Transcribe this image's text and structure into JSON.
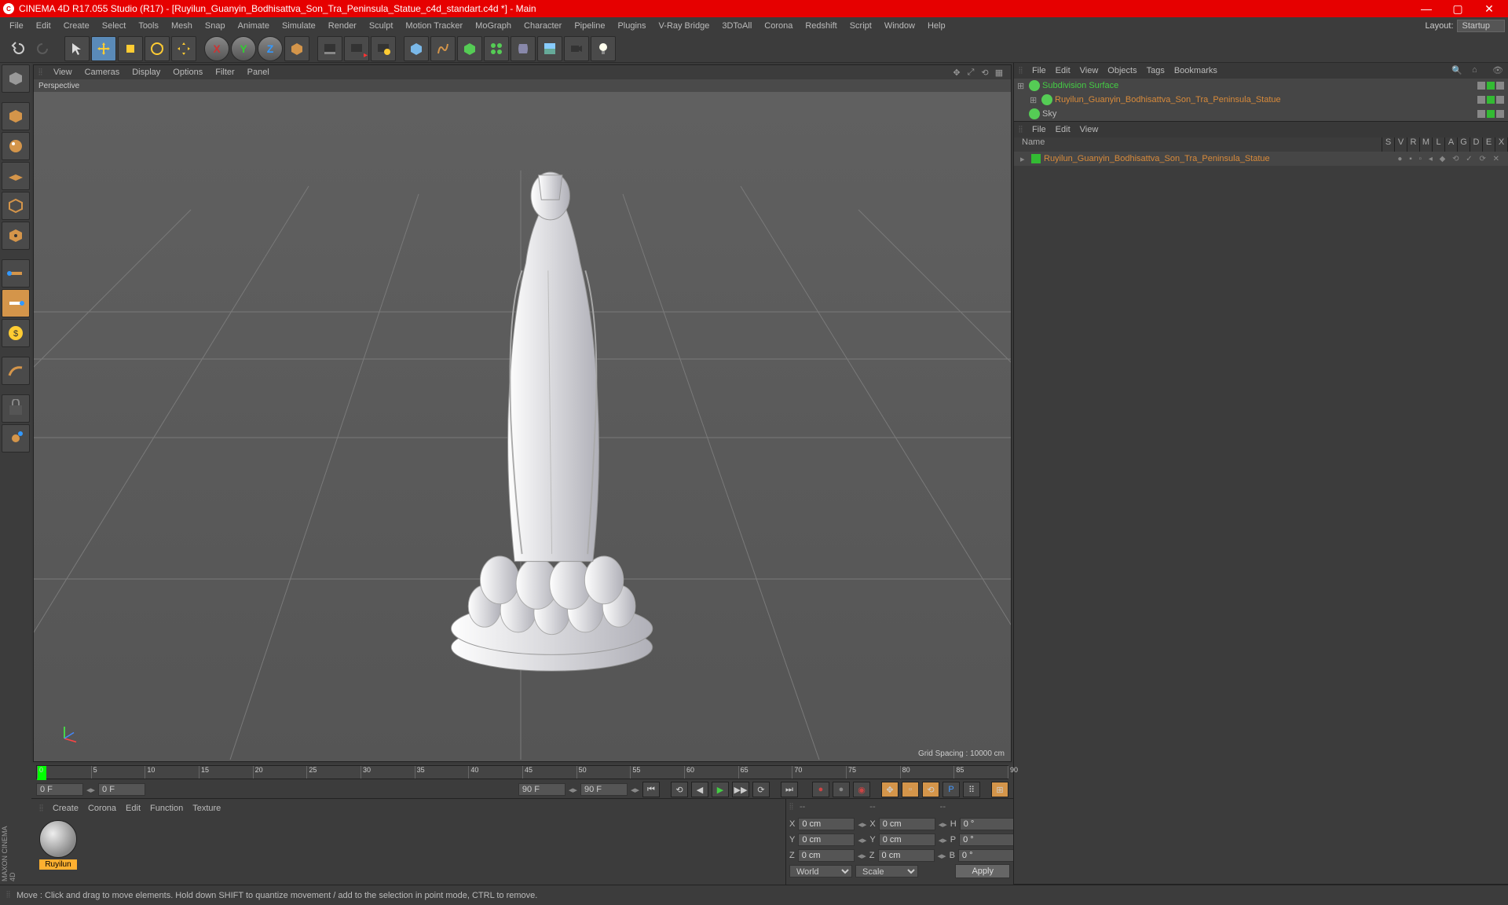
{
  "title": "CINEMA 4D R17.055 Studio (R17) - [Ruyilun_Guanyin_Bodhisattva_Son_Tra_Peninsula_Statue_c4d_standart.c4d *] - Main",
  "menus": [
    "File",
    "Edit",
    "Create",
    "Select",
    "Tools",
    "Mesh",
    "Snap",
    "Animate",
    "Simulate",
    "Render",
    "Sculpt",
    "Motion Tracker",
    "MoGraph",
    "Character",
    "Pipeline",
    "Plugins",
    "V-Ray Bridge",
    "3DToAll",
    "Corona",
    "Redshift",
    "Script",
    "Window",
    "Help"
  ],
  "layout": {
    "label": "Layout:",
    "value": "Startup"
  },
  "viewport": {
    "menus": [
      "View",
      "Cameras",
      "Display",
      "Options",
      "Filter",
      "Panel"
    ],
    "label": "Perspective",
    "grid_info": "Grid Spacing : 10000 cm"
  },
  "timeline": {
    "ticks": [
      "0",
      "5",
      "10",
      "15",
      "20",
      "25",
      "30",
      "35",
      "40",
      "45",
      "50",
      "55",
      "60",
      "65",
      "70",
      "75",
      "80",
      "85",
      "90"
    ],
    "frame_start": "0 F",
    "frame_end": "90 F",
    "frame_end2": "90 F",
    "current": "0 F",
    "end_label": "0 F"
  },
  "materials": {
    "menus": [
      "Create",
      "Corona",
      "Edit",
      "Function",
      "Texture"
    ],
    "item": "Ruyilun"
  },
  "coords": {
    "X": "0 cm",
    "Y": "0 cm",
    "Z": "0 cm",
    "X2": "0 cm",
    "Y2": "0 cm",
    "Z2": "0 cm",
    "H": "0 °",
    "P": "0 °",
    "B": "0 °",
    "world": "World",
    "scale": "Scale",
    "apply": "Apply"
  },
  "objects": {
    "menus": [
      "File",
      "Edit",
      "View",
      "Objects",
      "Tags",
      "Bookmarks"
    ],
    "items": [
      {
        "name": "Subdivision Surface",
        "color": "#4c4",
        "indent": 0,
        "exp": "⊞"
      },
      {
        "name": "Ruyilun_Guanyin_Bodhisattva_Son_Tra_Peninsula_Statue",
        "color": "#d88a3a",
        "indent": 1,
        "exp": "⊞"
      },
      {
        "name": "Sky",
        "color": "#bbb",
        "indent": 0,
        "exp": ""
      }
    ]
  },
  "takes": {
    "menus": [
      "File",
      "Edit",
      "View"
    ],
    "header_name": "Name",
    "cols": [
      "S",
      "V",
      "R",
      "M",
      "L",
      "A",
      "G",
      "D",
      "E",
      "X"
    ],
    "item": "Ruyilun_Guanyin_Bodhisattva_Son_Tra_Peninsula_Statue"
  },
  "status": "Move : Click and drag to move elements. Hold down SHIFT to quantize movement / add to the selection in point mode, CTRL to remove.",
  "brand": "MAXON CINEMA 4D"
}
